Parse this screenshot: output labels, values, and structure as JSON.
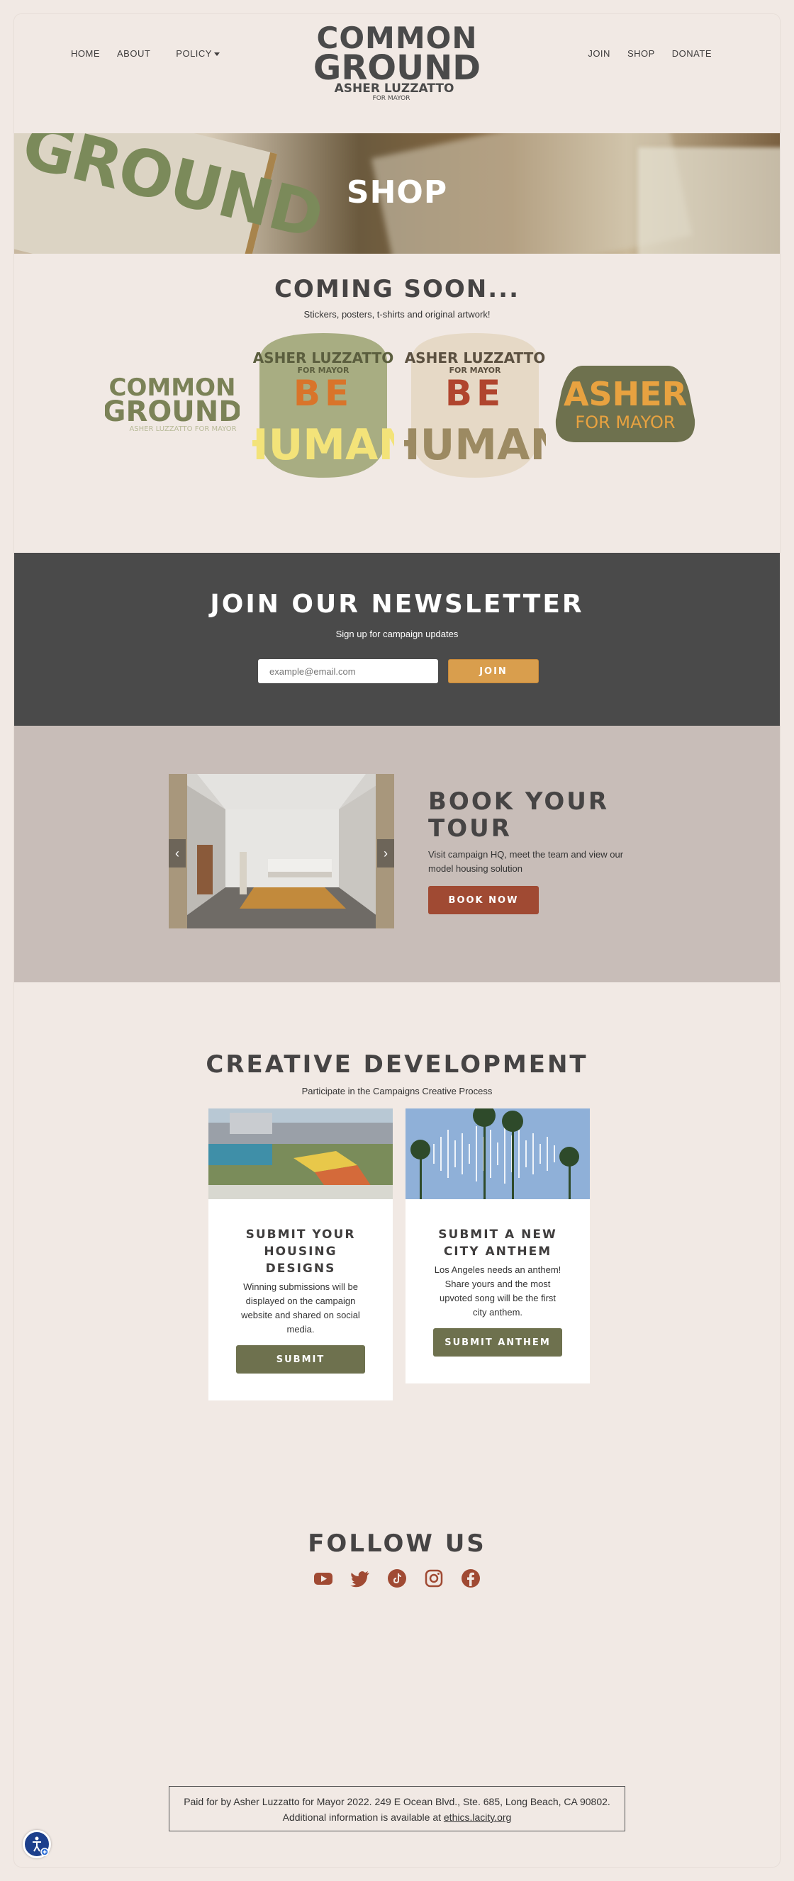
{
  "nav": {
    "left": [
      "HOME",
      "ABOUT",
      "POLICY"
    ],
    "right": [
      "JOIN",
      "SHOP",
      "DONATE"
    ]
  },
  "logo": {
    "line1": "COMMON",
    "line2": "GROUND",
    "line3": "ASHER LUZZATTO",
    "line4": "FOR MAYOR"
  },
  "hero": {
    "title": "SHOP",
    "box_text": "GROUND"
  },
  "coming": {
    "title": "COMING SOON...",
    "subtitle": "Stickers, posters, t-shirts and original artwork!",
    "sticker1": {
      "l1": "COMMON",
      "l2": "GROUND",
      "l3": "ASHER LUZZATTO FOR MAYOR"
    },
    "sticker2": {
      "l1": "ASHER LUZZATTO",
      "l2": "FOR MAYOR",
      "l3": "BE",
      "l4": "HUMAN"
    },
    "sticker3": {
      "l1": "ASHER LUZZATTO",
      "l2": "FOR MAYOR",
      "l3": "BE",
      "l4": "HUMAN"
    },
    "sticker4": {
      "l1": "ASHER",
      "l2": "FOR MAYOR"
    }
  },
  "newsletter": {
    "title": "JOIN OUR NEWSLETTER",
    "subtitle": "Sign up for campaign updates",
    "placeholder": "example@email.com",
    "button": "JOIN"
  },
  "tour": {
    "title": "BOOK YOUR TOUR",
    "description": "Visit campaign HQ, meet the team and view our model housing solution",
    "button": "BOOK NOW"
  },
  "creative": {
    "title": "CREATIVE DEVELOPMENT",
    "subtitle": "Participate in the Campaigns Creative Process",
    "cards": [
      {
        "title": "SUBMIT YOUR HOUSING DESIGNS",
        "text": "Winning submissions will be displayed on the campaign website and shared on social media.",
        "button": "SUBMIT"
      },
      {
        "title": "SUBMIT A NEW CITY ANTHEM",
        "text": "Los Angeles needs an anthem! Share yours and the most upvoted song will be the first city anthem.",
        "button": "SUBMIT ANTHEM"
      }
    ]
  },
  "follow": {
    "title": "FOLLOW US",
    "icons": [
      "youtube-icon",
      "twitter-icon",
      "tiktok-icon",
      "instagram-icon",
      "facebook-icon"
    ]
  },
  "footer": {
    "text": "Paid for by Asher Luzzatto for Mayor 2022. 249 E Ocean Blvd., Ste. 685, Long Beach, CA 90802. Additional information is available at",
    "link": "ethics.lacity.org"
  },
  "colors": {
    "rust": "#a04a33",
    "olive": "#6e714e",
    "gold": "#d99e4d",
    "charcoal": "#4a4a4a",
    "cream": "#f1e9e4"
  }
}
